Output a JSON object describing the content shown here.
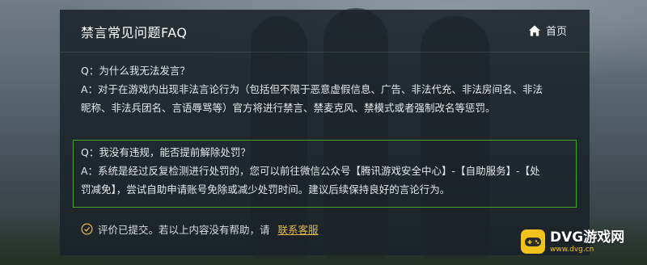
{
  "panel": {
    "title": "禁言常见问题FAQ",
    "home_label": "首页"
  },
  "faq": [
    {
      "question": "Q：为什么我无法发言？",
      "answer_line1": "A：对于在游戏内出现非法言论行为（包括但不限于恶意虚假信息、广告、非法代充、非法房间名、非法",
      "answer_line2": "昵称、非法兵团名、言语辱骂等）官方将进行禁言、禁麦克风、禁模式或者强制改名等惩罚。"
    },
    {
      "question": "Q：我没有违规，能否提前解除处罚？",
      "answer_line1": "A：系统是经过反复检测进行处罚的，您可以前往微信公众号【腾讯游戏安全中心】-【自助服务】-【处",
      "answer_line2": "罚减免】，尝试自助申请账号免除或减少处罚时间。建议后续保持良好的言论行为。"
    }
  ],
  "footer": {
    "feedback_text": "评价已提交。若以上内容没有帮助，请",
    "contact_link": "联系客服"
  },
  "watermark": {
    "brand": "DVG游戏网",
    "domain": "www.dvg.cn"
  },
  "colors": {
    "highlight_border": "#43a32b",
    "link": "#e5b84a",
    "logo": "#f1c21b"
  }
}
